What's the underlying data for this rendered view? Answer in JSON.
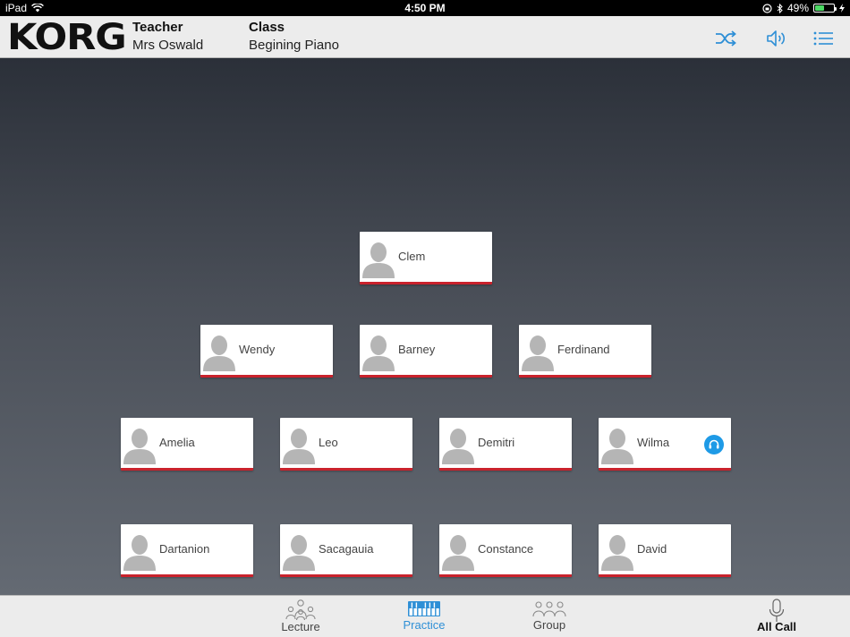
{
  "status_bar": {
    "device": "iPad",
    "time": "4:50 PM",
    "battery": "49%",
    "battery_level": 0.49
  },
  "header": {
    "logo": "KORG",
    "teacher_label": "Teacher",
    "teacher_name": "Mrs Oswald",
    "class_label": "Class",
    "class_name": "Begining Piano"
  },
  "students": {
    "clem": "Clem",
    "wendy": "Wendy",
    "barney": "Barney",
    "ferdinand": "Ferdinand",
    "amelia": "Amelia",
    "leo": "Leo",
    "demitri": "Demitri",
    "wilma": "Wilma",
    "dartanion": "Dartanion",
    "sacagauia": "Sacagauia",
    "constance": "Constance",
    "david": "David"
  },
  "tabs": {
    "lecture": "Lecture",
    "practice": "Practice",
    "group": "Group",
    "all_call": "All Call"
  },
  "colors": {
    "accent_blue": "#2e8fd6",
    "card_underline": "#c9222c",
    "headset_badge": "#1e9ae6"
  },
  "icons": {
    "header": [
      "shuffle-icon",
      "speaker-icon",
      "list-icon"
    ],
    "tabs": [
      "lecture-icon",
      "piano-keys-icon",
      "group-icon",
      "microphone-icon"
    ]
  }
}
